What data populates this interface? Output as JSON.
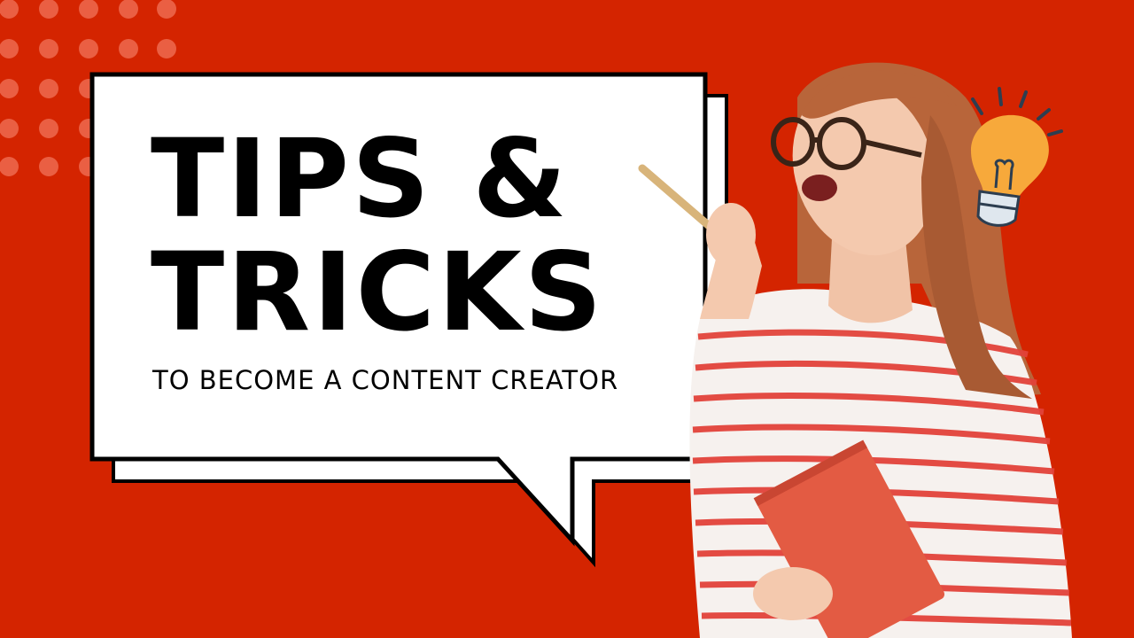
{
  "thumbnail": {
    "headline_line1": "TIPS &",
    "headline_line2": "TRICKS",
    "subline": "TO BECOME A CONTENT CREATOR"
  },
  "colors": {
    "background": "#d42400",
    "bubble_fill": "#ffffff",
    "bubble_outline": "#000000",
    "text": "#000000",
    "dots": "#ee6a4f",
    "shirt_stripes": "#e2433a",
    "notebook": "#e35b43",
    "hair": "#b8653a",
    "bulb": "#f7a93b"
  },
  "decorations": {
    "background_dot_pattern": "dots",
    "speech_bubble": "speech-bubble",
    "person_photo": "woman-with-pencil-and-notebook",
    "idea_icon": "lightbulb-icon"
  }
}
